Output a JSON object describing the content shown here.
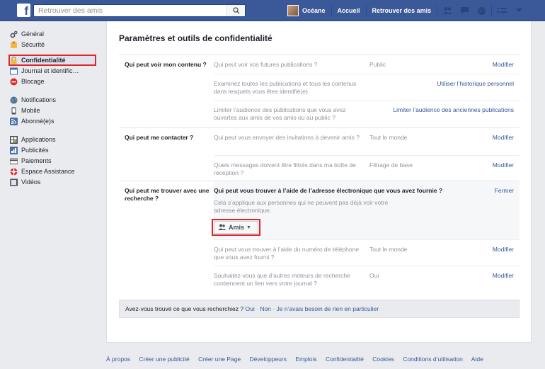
{
  "topbar": {
    "logo": "f",
    "search_placeholder": "Retrouver des amis",
    "user_name": "Océane",
    "links": [
      "Accueil",
      "Retrouver des amis"
    ]
  },
  "sidebar": {
    "groups": [
      [
        {
          "label": "Général",
          "icon": "gear-icon"
        },
        {
          "label": "Sécurité",
          "icon": "badge-icon"
        }
      ],
      [
        {
          "label": "Confidentialité",
          "icon": "lock-icon",
          "active": true
        },
        {
          "label": "Journal et identific…",
          "icon": "timeline-icon"
        },
        {
          "label": "Blocage",
          "icon": "block-icon"
        }
      ],
      [
        {
          "label": "Notifications",
          "icon": "globe-icon"
        },
        {
          "label": "Mobile",
          "icon": "mobile-icon"
        },
        {
          "label": "Abonné(e)s",
          "icon": "rss-icon"
        }
      ],
      [
        {
          "label": "Applications",
          "icon": "apps-icon"
        },
        {
          "label": "Publicités",
          "icon": "ads-icon"
        },
        {
          "label": "Paiements",
          "icon": "card-icon"
        },
        {
          "label": "Espace Assistance",
          "icon": "help-icon"
        },
        {
          "label": "Vidéos",
          "icon": "video-icon"
        }
      ]
    ]
  },
  "main": {
    "title": "Paramètres et outils de confidentialité",
    "s1": {
      "heading": "Qui peut voir mon contenu ?",
      "r1": {
        "q": "Qui peut voir vos futures publications ?",
        "v": "Public",
        "a": "Modifier"
      },
      "r2": {
        "q": "Examinez toutes les publications et tous les contenus dans lesquels vous êtes identifié(e)",
        "a": "Utiliser l’historique personnel"
      },
      "r3": {
        "q": "Limiter l’audience des publications que vous avez ouvertes aux amis de vos amis ou au public ?",
        "a": "Limiter l’audience des anciennes publications"
      }
    },
    "s2": {
      "heading": "Qui peut me contacter ?",
      "r1": {
        "q": "Qui peut vous envoyer des invitations à devenir amis ?",
        "v": "Tout le monde",
        "a": "Modifier"
      },
      "r2": {
        "q": "Quels messages doivent être filtrés dans ma boîte de réception ?",
        "v": "Filtrage de base",
        "a": "Modifier"
      }
    },
    "s3": {
      "heading": "Qui peut me trouver avec une recherche ?",
      "exp": {
        "q": "Qui peut vous trouver à l’aide de l’adresse électronique que vous avez fournie ?",
        "a": "Fermer",
        "d": "Cela s’applique aux personnes qui ne peuvent pas déjà voir votre adresse électronique.",
        "button": "Amis"
      },
      "r2": {
        "q": "Qui peut vous trouver à l’aide du numéro de téléphone que vous avez fourni ?",
        "v": "Tout le monde",
        "a": "Modifier"
      },
      "r3": {
        "q": "Souhaitez-vous que d’autres moteurs de recherche contiennent un lien vers votre journal ?",
        "v": "Oui",
        "a": "Modifier"
      }
    },
    "found": {
      "q": "Avez-vous trouvé ce que vous recherchiez ?",
      "yes": "Oui",
      "no": "Non",
      "none": "Je n’avais besoin de rien en particulier",
      "sep": "·"
    }
  },
  "footer": [
    "À propos",
    "Créer une publicité",
    "Créer une Page",
    "Développeurs",
    "Emplois",
    "Confidentialité",
    "Cookies",
    "Conditions d’utilisation",
    "Aide"
  ]
}
